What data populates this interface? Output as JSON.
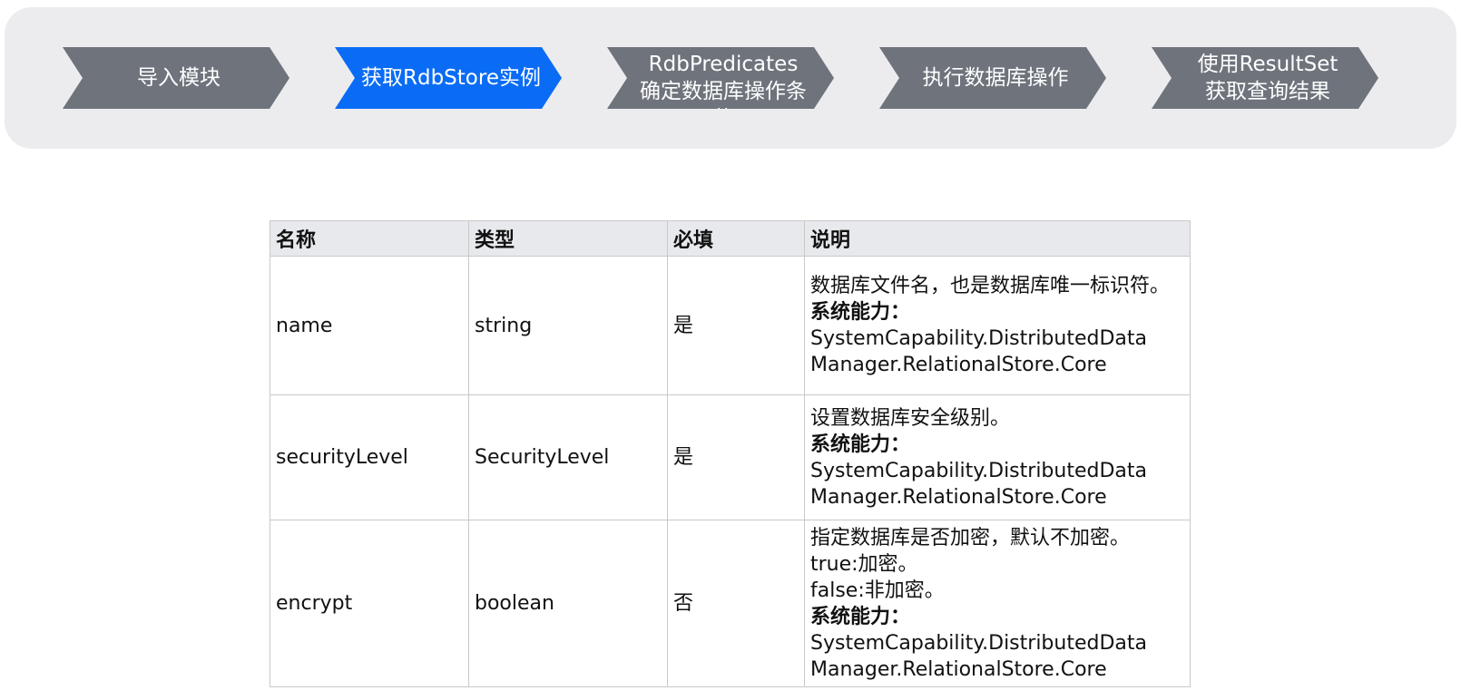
{
  "steps": [
    {
      "label": "导入模块",
      "active": false
    },
    {
      "label": "获取RdbStore实例",
      "active": true
    },
    {
      "label": "使用RdbPredicates\n确定数据库操作条件",
      "active": false
    },
    {
      "label": "执行数据库操作",
      "active": false
    },
    {
      "label": "使用ResultSet\n获取查询结果",
      "active": false
    }
  ],
  "table": {
    "headers": [
      "名称",
      "类型",
      "必填",
      "说明"
    ],
    "rows": [
      {
        "name": "name",
        "type": "string",
        "required": "是",
        "desc": [
          {
            "text": "数据库文件名，也是数据库唯一标识符。",
            "bold": false
          },
          {
            "text": "系统能力：",
            "bold": true
          },
          {
            "text": " SystemCapability.DistributedData",
            "bold": false
          },
          {
            "text": "Manager.RelationalStore.Core",
            "bold": false
          }
        ]
      },
      {
        "name": "securityLevel",
        "type": "SecurityLevel",
        "required": "是",
        "desc": [
          {
            "text": "设置数据库安全级别。",
            "bold": false
          },
          {
            "text": "系统能力：",
            "bold": true
          },
          {
            "text": " SystemCapability.DistributedData",
            "bold": false
          },
          {
            "text": "Manager.RelationalStore.Core",
            "bold": false
          }
        ]
      },
      {
        "name": "encrypt",
        "type": "boolean",
        "required": "否",
        "desc": [
          {
            "text": "指定数据库是否加密，默认不加密。",
            "bold": false
          },
          {
            "text": "true:加密。",
            "bold": false
          },
          {
            "text": "false:非加密。",
            "bold": false
          },
          {
            "text": "系统能力：",
            "bold": true
          },
          {
            "text": " SystemCapability.DistributedData",
            "bold": false
          },
          {
            "text": "Manager.RelationalStore.Core",
            "bold": false
          }
        ]
      }
    ]
  },
  "colors": {
    "step_default": "#6e737c",
    "step_active": "#0a6cf5",
    "bar_background": "#ececef",
    "header_background": "#e8e9ec"
  }
}
